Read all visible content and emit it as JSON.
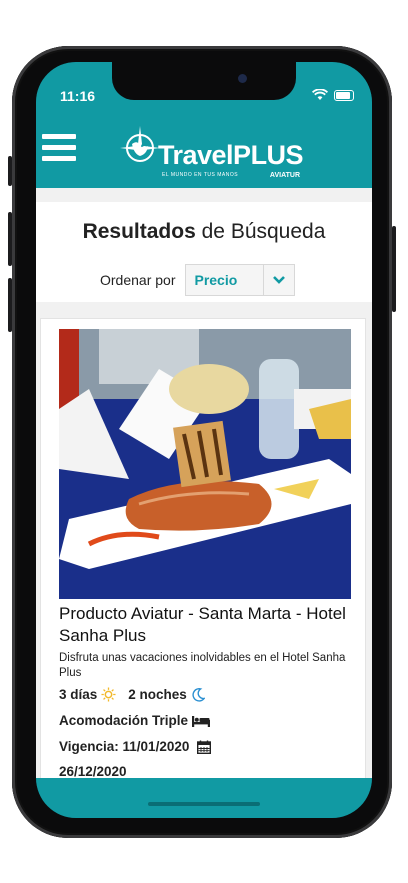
{
  "status_bar": {
    "time": "11:16"
  },
  "header": {
    "logo_text": "TravelPLUS",
    "logo_tagline": "EL MUNDO EN TUS MANOS",
    "logo_brand": "AVIATUR"
  },
  "search": {
    "heading_bold": "Resultados",
    "heading_rest": "de Búsqueda",
    "sort_label": "Ordenar por",
    "sort_value": "Precio"
  },
  "result": {
    "title": "Producto Aviatur - Santa Marta - Hotel Sanha Plus",
    "description": "Disfruta unas vacaciones inolvidables en el Hotel Sanha Plus",
    "days": "3 días",
    "nights": "2 noches",
    "accommodation": "Acomodación Triple",
    "validity": "Vigencia: 11/01/2020",
    "validity_end": "26/12/2020",
    "icons": {
      "days": "sun-icon",
      "nights": "moon-icon",
      "accommodation": "bed-icon",
      "validity": "calendar-icon"
    }
  },
  "colors": {
    "brand": "#119aa3",
    "accent_sun": "#f2b92b",
    "accent_moon": "#2a8fd1"
  }
}
